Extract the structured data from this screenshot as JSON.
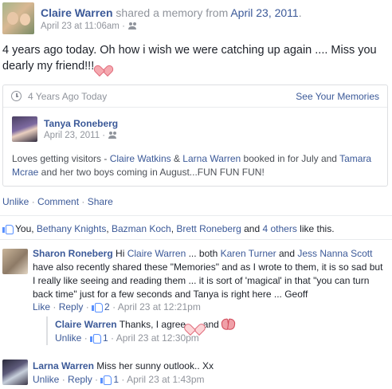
{
  "post": {
    "author": "Claire Warren",
    "shared_text": " shared a memory from ",
    "memory_date": "April 23, 2011",
    "period": ".",
    "timestamp": "April 23 at 11:06am ·",
    "audience_icon": "friends-icon",
    "message": "4 years ago today. Oh how i wish we were catching up again .... Miss you dearly my friend!!! "
  },
  "memory": {
    "age_label": "4 Years Ago Today",
    "see_memories": "See Your Memories",
    "original_author": "Tanya Roneberg",
    "original_date": "April 23, 2011 ·",
    "text_prefix": "Loves getting visitors - ",
    "tag1": "Claire Watkins",
    "amp": " & ",
    "tag2": "Larna Warren",
    "text_mid": " booked in for July and ",
    "tag3": "Tamara Mcrae",
    "text_end": " and her two boys coming in August...FUN FUN FUN!"
  },
  "actions": {
    "unlike": "Unlike",
    "comment": "Comment",
    "share": "Share",
    "sep": " · "
  },
  "likes": {
    "you": "You, ",
    "people": [
      "Bethany Knights",
      "Bazman Koch",
      "Brett Roneberg"
    ],
    "comma": ", ",
    "and": " and ",
    "others": "4 others",
    "suffix": " like this."
  },
  "comments": [
    {
      "author": "Sharon Roneberg",
      "t1": " Hi ",
      "m1": "Claire Warren",
      "t2": " ... both ",
      "m2": "Karen Turner",
      "t3": " and ",
      "m3": "Jess Nanna Scott",
      "t4": " have also recently shared these \"Memories\" and as I wrote to them, it is so sad but I really like seeing and reading them ... it is sort of 'magical' in that \"you can turn back time\" just for a few seconds and Tanya is right here ... Geoff",
      "like": "Like",
      "reply": "Reply",
      "like_count": "2",
      "time": "April 23 at 12:21pm"
    },
    {
      "author": "Claire Warren",
      "text": " Thanks, I agree ",
      "and": " and ",
      "unlike": "Unlike",
      "like_count": "1",
      "time": "April 23 at 12:30pm"
    },
    {
      "author": "Larna Warren",
      "text": " Miss her sunny outlook.. Xx",
      "unlike": "Unlike",
      "reply": "Reply",
      "like_count": "1",
      "time": "April 23 at 1:43pm"
    }
  ],
  "colors": {
    "link": "#3b5998",
    "meta": "#90949c",
    "heart": "#f5a9b0"
  }
}
